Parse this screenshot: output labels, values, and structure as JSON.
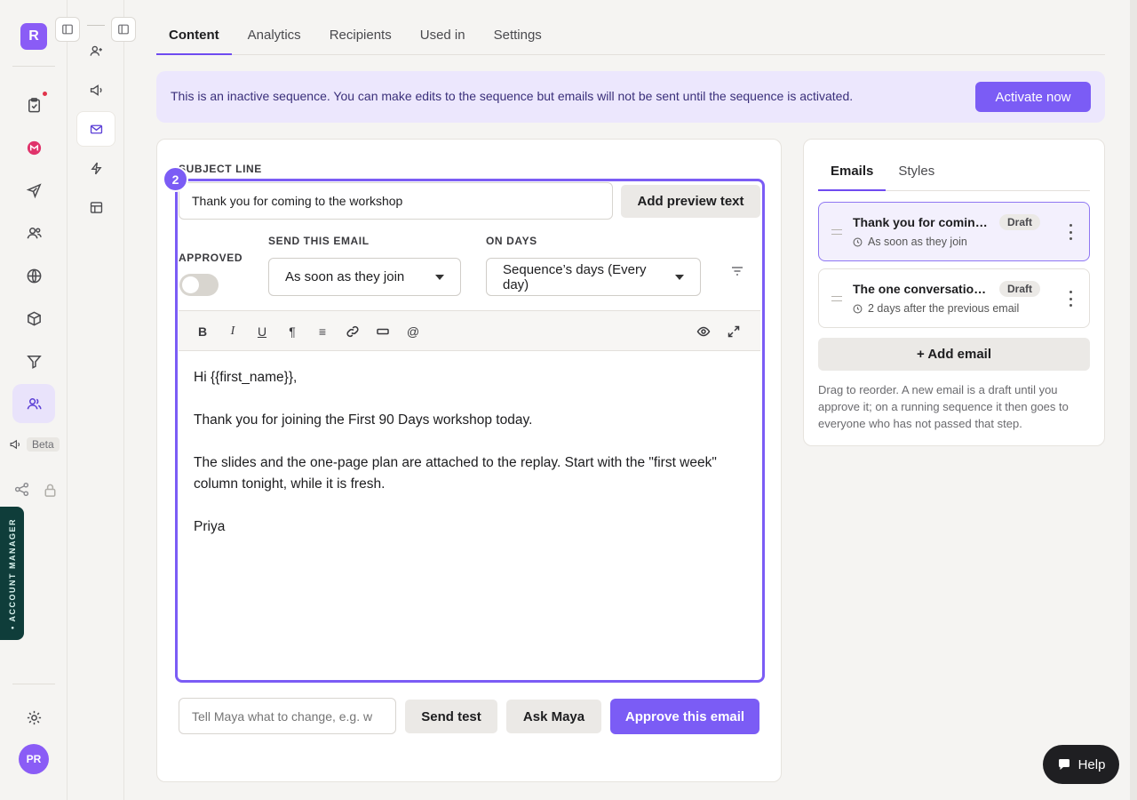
{
  "rail": {
    "logo_letter": "R",
    "beta_label": "Beta",
    "account_manager_label": "• ACCOUNT MANAGER",
    "avatar_initials": "PR"
  },
  "tabs": [
    {
      "label": "Content"
    },
    {
      "label": "Analytics"
    },
    {
      "label": "Recipients"
    },
    {
      "label": "Used in"
    },
    {
      "label": "Settings"
    }
  ],
  "banner": {
    "text": "This is an inactive sequence. You can make edits to the sequence but emails will not be sent until the sequence is activated.",
    "button": "Activate now"
  },
  "editor": {
    "step_number": "2",
    "subject_label": "SUBJECT LINE",
    "subject_value": "Thank you for coming to the workshop",
    "preview_button": "Add preview text",
    "approved_label": "APPROVED",
    "approved": false,
    "send_label": "SEND THIS EMAIL",
    "send_value": "As soon as they join",
    "days_label": "ON DAYS",
    "days_value": "Sequence’s days (Every day)",
    "toolbar": {
      "bold": "B",
      "italic": "I",
      "underline": "U",
      "paragraph": "¶",
      "list": "≡",
      "mention": "@"
    },
    "body": [
      "Hi {{first_name}},",
      "Thank you for joining the First 90 Days workshop today.",
      "The slides and the one-page plan are attached to the replay. Start with the \"first week\" column tonight, while it is fresh.",
      "Priya"
    ],
    "maya_placeholder": "Tell Maya what to change, e.g. w",
    "send_test": "Send test",
    "ask_maya": "Ask Maya",
    "approve": "Approve this email"
  },
  "panel": {
    "tabs": [
      {
        "label": "Emails"
      },
      {
        "label": "Styles"
      }
    ],
    "emails": [
      {
        "title": "Thank you for coming to the workshop",
        "badge": "Draft",
        "timing": "As soon as they join"
      },
      {
        "title": "The one conversation to have this week",
        "badge": "Draft",
        "timing": "2 days after the previous email"
      }
    ],
    "add_email": "+ Add email",
    "help_text": "Drag to reorder. A new email is a draft until you approve it; on a running sequence it then goes to everyone who has not passed that step."
  },
  "help_button": "Help",
  "colors": {
    "accent": "#7b5cf5",
    "banner_bg": "#ece7fd",
    "account_tab": "#0f3d3a"
  }
}
